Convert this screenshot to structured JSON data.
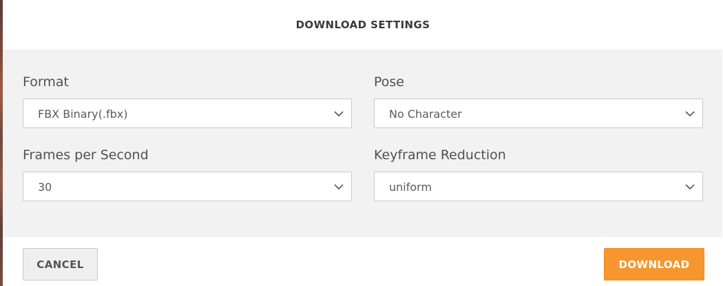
{
  "dialog": {
    "title": "DOWNLOAD SETTINGS"
  },
  "fields": {
    "format": {
      "label": "Format",
      "value": "FBX Binary(.fbx)"
    },
    "pose": {
      "label": "Pose",
      "value": "No Character"
    },
    "fps": {
      "label": "Frames per Second",
      "value": "30"
    },
    "keyframe_reduction": {
      "label": "Keyframe Reduction",
      "value": "uniform"
    }
  },
  "footer": {
    "cancel_label": "CANCEL",
    "download_label": "DOWNLOAD"
  },
  "colors": {
    "accent": "#f5962f",
    "panel_bg": "#f2f2f2",
    "text": "#505050"
  },
  "icons": {
    "dropdown": "chevron-down-icon"
  }
}
